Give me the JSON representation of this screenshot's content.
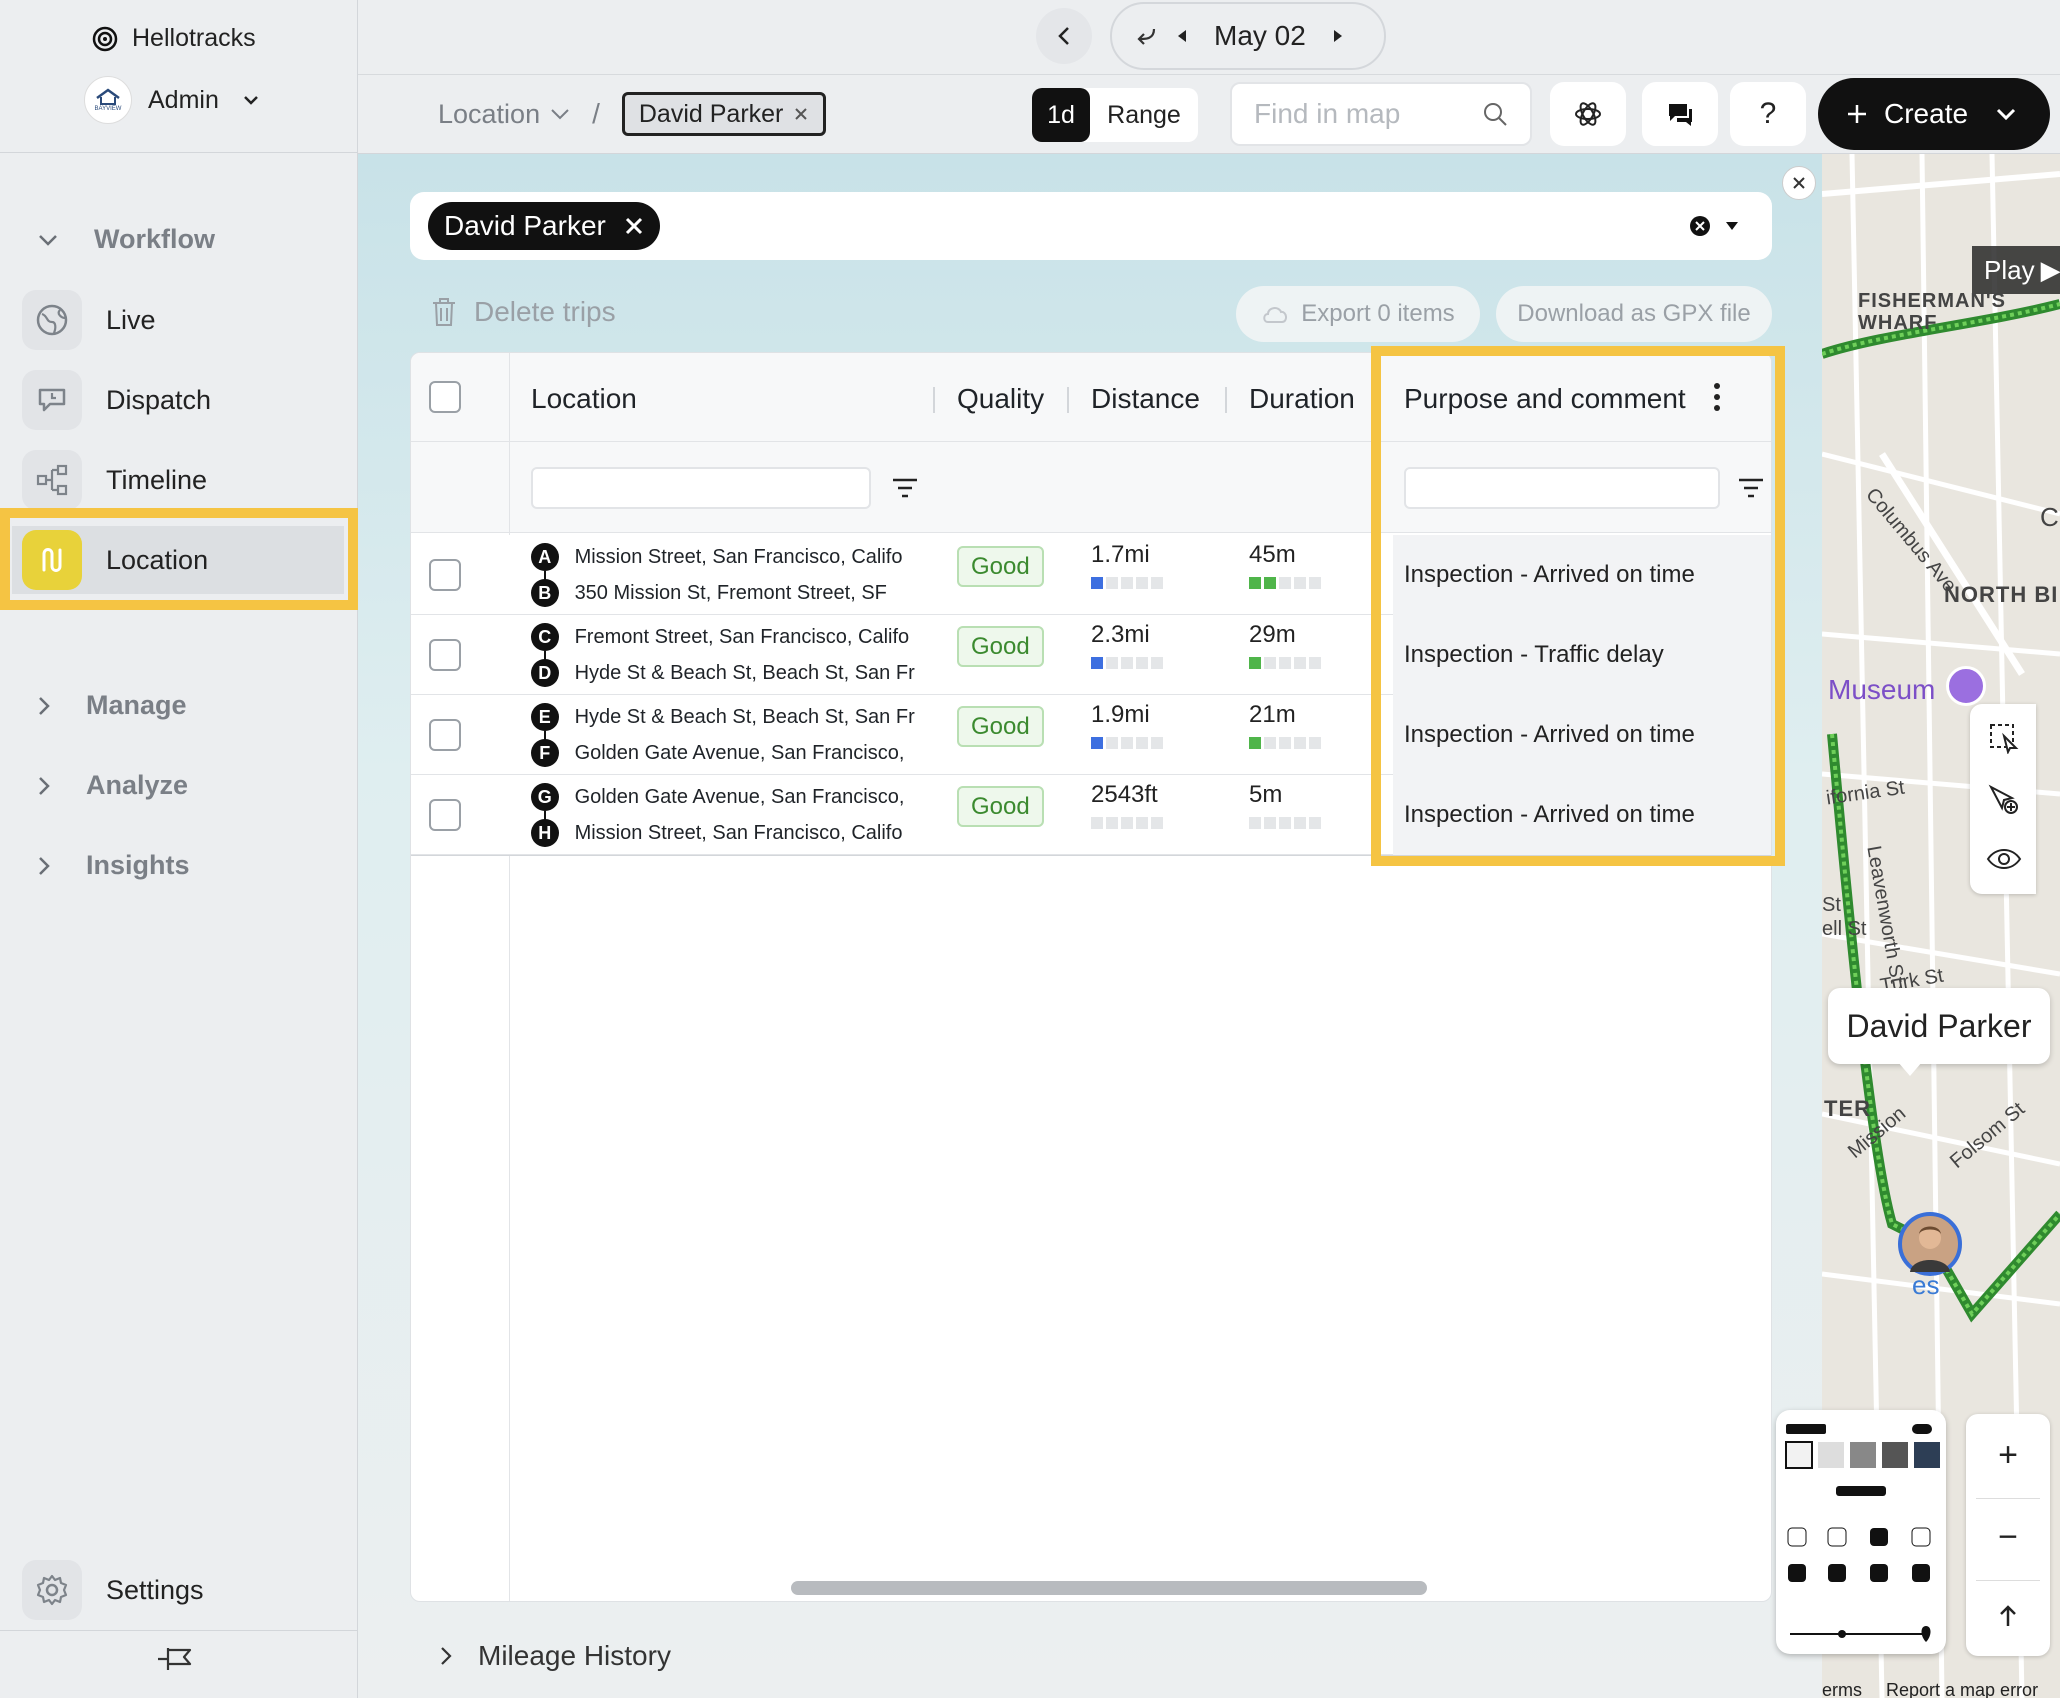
{
  "app": {
    "name": "Hellotracks",
    "account": "Admin",
    "logo_text": "BAYVIEW"
  },
  "sidebar": {
    "workflow": "Workflow",
    "items": [
      {
        "label": "Live",
        "icon": "globe-icon"
      },
      {
        "label": "Dispatch",
        "icon": "chat-pin-icon"
      },
      {
        "label": "Timeline",
        "icon": "timeline-icon"
      },
      {
        "label": "Location",
        "icon": "route-icon"
      }
    ],
    "groups": [
      {
        "label": "Manage"
      },
      {
        "label": "Analyze"
      },
      {
        "label": "Insights"
      }
    ],
    "settings": "Settings"
  },
  "date_nav": {
    "date": "May 02"
  },
  "breadcrumb": {
    "root": "Location",
    "separator": "/",
    "chip": "David Parker"
  },
  "toolbar": {
    "mode_1d": "1d",
    "mode_range": "Range",
    "search_placeholder": "Find in map",
    "help": "?",
    "create": "Create"
  },
  "filter": {
    "chip": "David Parker"
  },
  "actions": {
    "delete": "Delete trips",
    "export": "Export 0 items",
    "download": "Download as GPX file"
  },
  "table": {
    "headers": {
      "location": "Location",
      "quality": "Quality",
      "distance": "Distance",
      "duration": "Duration",
      "purpose": "Purpose and comment"
    },
    "rows": [
      {
        "from_letter": "A",
        "from": "Mission Street, San Francisco, Califo",
        "to_letter": "B",
        "to": "350 Mission St, Fremont Street, SF",
        "quality": "Good",
        "distance": "1.7mi",
        "dist_level": 1,
        "duration": "45m",
        "dur_level": 2,
        "purpose": "Inspection - Arrived on time"
      },
      {
        "from_letter": "C",
        "from": "Fremont Street, San Francisco, Califo",
        "to_letter": "D",
        "to": "Hyde St & Beach St, Beach St, San Fr",
        "quality": "Good",
        "distance": "2.3mi",
        "dist_level": 1,
        "duration": "29m",
        "dur_level": 1,
        "purpose": "Inspection - Traffic delay"
      },
      {
        "from_letter": "E",
        "from": "Hyde St & Beach St, Beach St, San Fr",
        "to_letter": "F",
        "to": "Golden Gate Avenue, San Francisco,",
        "quality": "Good",
        "distance": "1.9mi",
        "dist_level": 1,
        "duration": "21m",
        "dur_level": 1,
        "purpose": "Inspection - Arrived on time"
      },
      {
        "from_letter": "G",
        "from": "Golden Gate Avenue, San Francisco,",
        "to_letter": "H",
        "to": "Mission Street, San Francisco, Califo",
        "quality": "Good",
        "distance": "2543ft",
        "dist_level": 0,
        "duration": "5m",
        "dur_level": 0,
        "purpose": "Inspection - Arrived on time"
      }
    ]
  },
  "mileage": {
    "label": "Mileage History"
  },
  "map": {
    "play": "Play",
    "labels": {
      "wharf": "FISHERMAN'S WHARF",
      "columbus": "Columbus Ave",
      "north": "NORTH BI",
      "museum": "Museum",
      "california": "ifornia St",
      "leavenworth": "Leavenworth St",
      "turk": "Turk St",
      "mission": "Mission",
      "folsom": "Folsom St",
      "ter": "TER",
      "c": "C",
      "st": "St",
      "ell": "ell St",
      "es": "es",
      "footer_terms": "erms",
      "footer_report": "Report a map error"
    },
    "person": "David Parker",
    "zoom_in": "+",
    "zoom_out": "−"
  },
  "colors": {
    "highlight": "#f5c443",
    "accent_yellow": "#e8d23a",
    "dark": "#111111",
    "good_green": "#3b8a2f",
    "bar_blue": "#3d6fe0",
    "bar_green": "#4fb54a"
  }
}
